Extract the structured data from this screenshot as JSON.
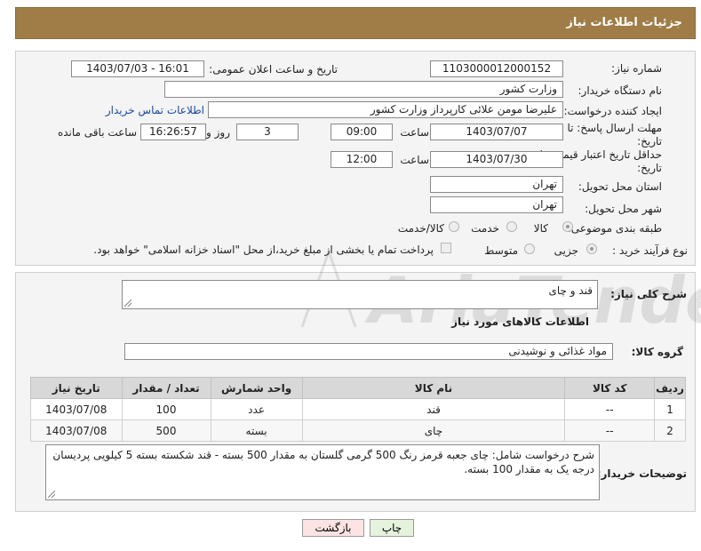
{
  "header": {
    "title": "جزئیات اطلاعات نیاز"
  },
  "form": {
    "need_number": {
      "label": "شماره نیاز:",
      "value": "1103000012000152"
    },
    "announce": {
      "label": "تاریخ و ساعت اعلان عمومی:",
      "value": "1403/07/03 - 16:01"
    },
    "buyer_org": {
      "label": "نام دستگاه خریدار:",
      "value": "وزارت کشور"
    },
    "requester": {
      "label": "ایجاد کننده درخواست:",
      "value": "علیرضا مومن علائی کارپرداز وزارت کشور",
      "contact_link": "اطلاعات تماس خریدار"
    },
    "reply_deadline": {
      "label1": "مهلت ارسال پاسخ: تا",
      "label2": "تاریخ:",
      "date": "1403/07/07",
      "time_label": "ساعت",
      "time": "09:00",
      "days": "3",
      "days_label": "روز و",
      "remaining": "16:26:57",
      "remaining_label": "ساعت باقی مانده"
    },
    "price_validity": {
      "label1": "حداقل تاریخ اعتبار قیمت: تا",
      "label2": "تاریخ:",
      "date": "1403/07/30",
      "time_label": "ساعت",
      "time": "12:00"
    },
    "province": {
      "label": "استان محل تحویل:",
      "value": "تهران"
    },
    "city": {
      "label": "شهر محل تحویل:",
      "value": "تهران"
    },
    "category": {
      "label": "طبقه بندی موضوعی:",
      "options": [
        "کالا",
        "خدمت",
        "کالا/خدمت"
      ],
      "selected": "کالا"
    },
    "purchase_type": {
      "label": "نوع فرآیند خرید :",
      "options": [
        "جزیی",
        "متوسط"
      ],
      "selected": "جزیی",
      "note": "پرداخت تمام یا بخشی از مبلغ خرید،از محل \"اسناد خزانه اسلامی\" خواهد بود."
    }
  },
  "summary": {
    "label": "شرح کلی نیاز:",
    "value": "قند و چای"
  },
  "goods_section": {
    "title": "اطلاعات کالاهای مورد نیاز"
  },
  "goods_group": {
    "label": "گروه کالا:",
    "value": "مواد غذائی و نوشیدنی"
  },
  "table": {
    "headers": [
      "ردیف",
      "کد کالا",
      "نام کالا",
      "واحد شمارش",
      "تعداد / مقدار",
      "تاریخ نیاز"
    ],
    "rows": [
      [
        "1",
        "--",
        "قند",
        "عدد",
        "100",
        "1403/07/08"
      ],
      [
        "2",
        "--",
        "چای",
        "بسته",
        "500",
        "1403/07/08"
      ]
    ]
  },
  "buyer_notes": {
    "label": "توضیحات خریدار:",
    "value": "شرح درخواست شامل: چای جعبه قرمز رنگ  500 گرمی گلستان به مقدار 500 بسته - قند شکسته بسته 5 کیلویی پردیسان درجه یک به مقدار 100 بسته."
  },
  "buttons": {
    "print": "چاپ",
    "back": "بازگشت"
  },
  "watermark": {
    "text": "AriaTender.neT"
  },
  "colors": {
    "header": "#a07c47",
    "link": "#1a4aa0",
    "back_button": "#fde3e3",
    "print_button": "#e6f3dc"
  }
}
